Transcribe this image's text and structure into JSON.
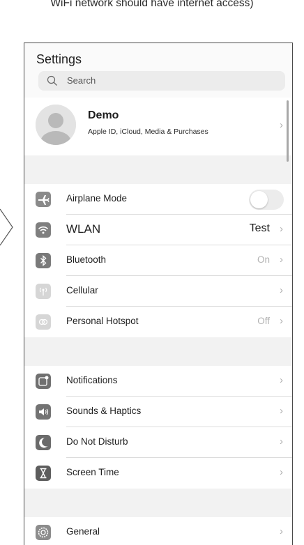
{
  "caption": "WiFi network should have internet access)",
  "settings": {
    "title": "Settings",
    "search_placeholder": "Search",
    "profile": {
      "name": "Demo",
      "subtitle": "Apple ID, iCloud, Media & Purchases"
    },
    "groups": [
      [
        {
          "label": "Airplane Mode",
          "icon": "airplane-icon",
          "color": "#8a8a8a",
          "toggle": "off"
        },
        {
          "label": "WLAN",
          "icon": "wifi-icon",
          "color": "#7f7f7f",
          "value": "Test"
        },
        {
          "label": "Bluetooth",
          "icon": "bluetooth-icon",
          "color": "#7a7a7a",
          "value": "On"
        },
        {
          "label": "Cellular",
          "icon": "cellular-icon",
          "color": "#d6d6d6",
          "value": ""
        },
        {
          "label": "Personal Hotspot",
          "icon": "hotspot-icon",
          "color": "#d6d6d6",
          "value": "Off"
        }
      ],
      [
        {
          "label": "Notifications",
          "icon": "notifications-icon",
          "color": "#707070"
        },
        {
          "label": "Sounds & Haptics",
          "icon": "speaker-icon",
          "color": "#737373"
        },
        {
          "label": "Do Not Disturb",
          "icon": "moon-icon",
          "color": "#6b6b6b"
        },
        {
          "label": "Screen Time",
          "icon": "hourglass-icon",
          "color": "#5d5d5d"
        }
      ],
      [
        {
          "label": "General",
          "icon": "gear-icon",
          "color": "#8c8c8c"
        }
      ]
    ]
  }
}
